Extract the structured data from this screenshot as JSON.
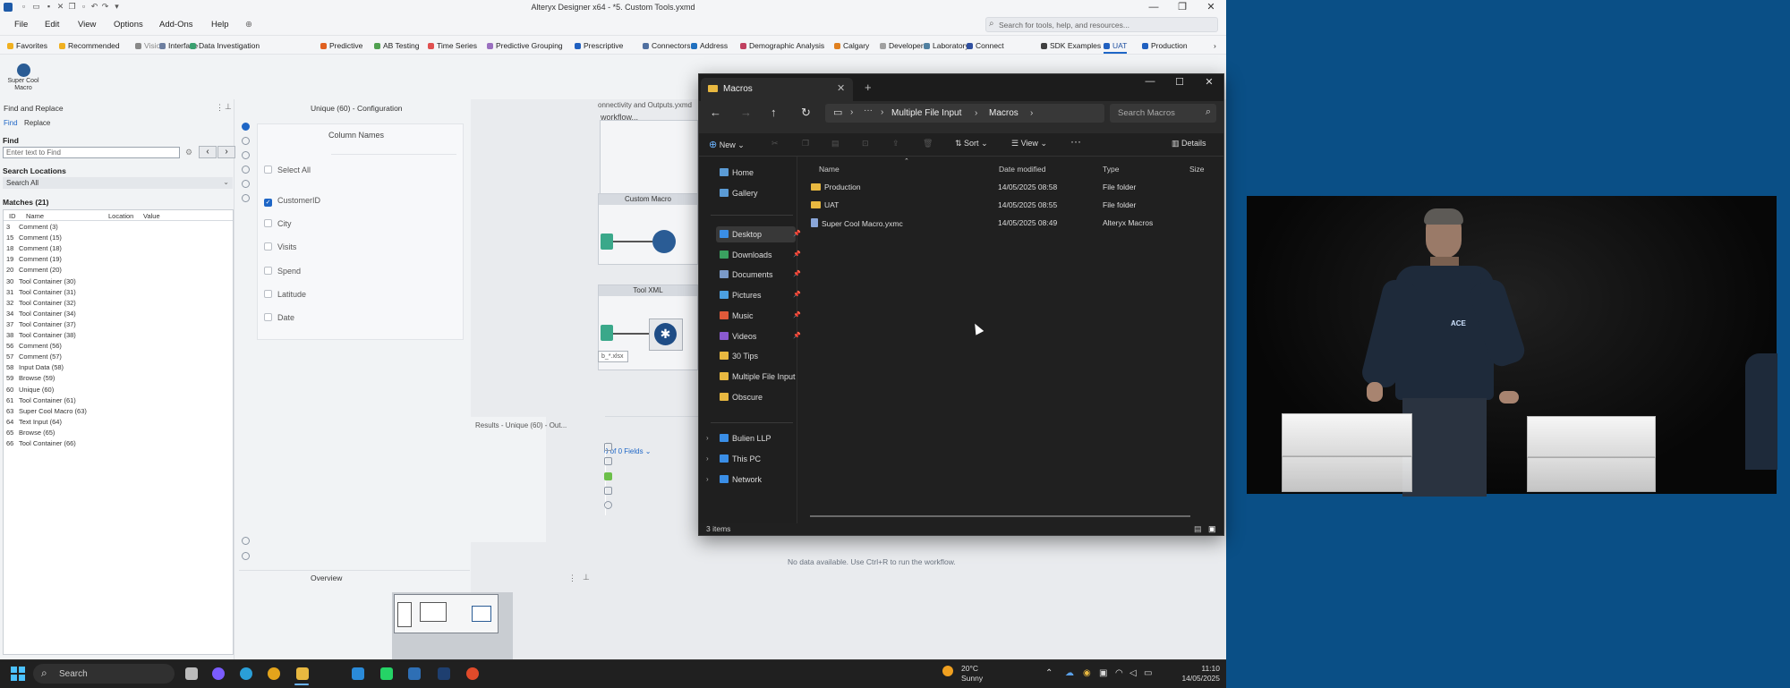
{
  "app": {
    "title": "Alteryx Designer x64 - *5. Custom Tools.yxmd",
    "search_placeholder": "Search for tools, help, and resources...",
    "menu": [
      "File",
      "Edit",
      "View",
      "Options",
      "Add-Ons",
      "Help"
    ]
  },
  "ribbon": {
    "tabs": [
      "Favorites",
      "Recommended",
      "Vision",
      "Interface",
      "Data Investigation",
      "Predictive",
      "AB Testing",
      "Time Series",
      "Predictive Grouping",
      "Prescriptive",
      "Connectors",
      "Address",
      "Demographic Analysis",
      "Calgary",
      "Developer",
      "Laboratory",
      "Connect",
      "SDK Examples",
      "UAT",
      "Production"
    ],
    "active": "UAT",
    "colors": [
      "#f0b020",
      "#f0b020",
      "#888888",
      "#6d7fa0",
      "#3aa070",
      "#e06020",
      "#50a050",
      "#e05050",
      "#9a70c0",
      "#2060c0",
      "#5070a0",
      "#2070c0",
      "#c04060",
      "#e08020",
      "#a0a0a0",
      "#5080a0",
      "#3050a0",
      "#404040",
      "#2060c0",
      "#2060c0"
    ]
  },
  "palette": {
    "tool_label": "Super Cool Macro"
  },
  "find_panel": {
    "title": "Find and Replace",
    "tabs": [
      "Find",
      "Replace"
    ],
    "find_label": "Find",
    "find_placeholder": "Enter text to Find",
    "search_locations_label": "Search Locations",
    "search_locations_value": "Search All",
    "matches_label": "Matches (21)",
    "columns": [
      "ID",
      "Name",
      "Location",
      "Value"
    ],
    "rows": [
      {
        "id": "3",
        "name": "Comment (3)"
      },
      {
        "id": "15",
        "name": "Comment (15)"
      },
      {
        "id": "18",
        "name": "Comment (18)"
      },
      {
        "id": "19",
        "name": "Comment (19)"
      },
      {
        "id": "20",
        "name": "Comment (20)"
      },
      {
        "id": "30",
        "name": "Tool Container (30)"
      },
      {
        "id": "31",
        "name": "Tool Container (31)"
      },
      {
        "id": "32",
        "name": "Tool Container (32)"
      },
      {
        "id": "34",
        "name": "Tool Container (34)"
      },
      {
        "id": "37",
        "name": "Tool Container (37)"
      },
      {
        "id": "38",
        "name": "Tool Container (38)"
      },
      {
        "id": "56",
        "name": "Comment (56)"
      },
      {
        "id": "57",
        "name": "Comment (57)"
      },
      {
        "id": "58",
        "name": "Input Data (58)"
      },
      {
        "id": "59",
        "name": "Browse (59)"
      },
      {
        "id": "60",
        "name": "Unique (60)"
      },
      {
        "id": "61",
        "name": "Tool Container (61)"
      },
      {
        "id": "63",
        "name": "Super Cool Macro (63)"
      },
      {
        "id": "64",
        "name": "Text Input (64)"
      },
      {
        "id": "65",
        "name": "Browse (65)"
      },
      {
        "id": "66",
        "name": "Tool Container (66)"
      }
    ]
  },
  "config": {
    "title": "Unique (60) - Configuration",
    "section": "Column Names",
    "select_all": "Select All",
    "columns": [
      {
        "name": "CustomerID",
        "checked": true
      },
      {
        "name": "City",
        "checked": false
      },
      {
        "name": "Visits",
        "checked": false
      },
      {
        "name": "Spend",
        "checked": false
      },
      {
        "name": "Latitude",
        "checked": false
      },
      {
        "name": "Date",
        "checked": false
      }
    ]
  },
  "canvas": {
    "tab_label": "onnectivity and Outputs.yxmd",
    "workflow_label": "workflow...",
    "container1": "Custom Macro",
    "container2": "Tool XML",
    "node_label": "b_*.xlsx",
    "results_title": "Results - Unique (60) - Out...",
    "fields_text": "0 of 0 Fields",
    "no_data": "No data available. Use Ctrl+R to run the workflow."
  },
  "overview": {
    "title": "Overview"
  },
  "explorer": {
    "tab_title": "Macros",
    "breadcrumb": [
      "Multiple File Input",
      "Macros"
    ],
    "search_placeholder": "Search Macros",
    "commands": {
      "new": "New",
      "sort": "Sort",
      "view": "View",
      "details": "Details"
    },
    "nav_quick": [
      {
        "label": "Home",
        "color": "#5b9bd5"
      },
      {
        "label": "Gallery",
        "color": "#5b9bd5"
      }
    ],
    "nav_pinned": [
      {
        "label": "Desktop",
        "color": "#3a8ee6",
        "pinned": true
      },
      {
        "label": "Downloads",
        "color": "#3aa060",
        "pinned": true
      },
      {
        "label": "Documents",
        "color": "#7a9ac8",
        "pinned": true
      },
      {
        "label": "Pictures",
        "color": "#4ca0e0",
        "pinned": true
      },
      {
        "label": "Music",
        "color": "#e05a3a",
        "pinned": true
      },
      {
        "label": "Videos",
        "color": "#8a5ad0",
        "pinned": true
      },
      {
        "label": "30 Tips",
        "color": "#e8b840",
        "pinned": false
      },
      {
        "label": "Multiple File Input",
        "color": "#e8b840",
        "pinned": false
      },
      {
        "label": "Obscure",
        "color": "#e8b840",
        "pinned": false
      }
    ],
    "nav_roots": [
      {
        "label": "Bulien LLP",
        "color": "#3a8ee6"
      },
      {
        "label": "This PC",
        "color": "#3a8ee6"
      },
      {
        "label": "Network",
        "color": "#3a8ee6"
      }
    ],
    "columns": [
      "Name",
      "Date modified",
      "Type",
      "Size"
    ],
    "files": [
      {
        "name": "Production",
        "date": "14/05/2025 08:58",
        "type": "File folder",
        "kind": "folder"
      },
      {
        "name": "UAT",
        "date": "14/05/2025 08:55",
        "type": "File folder",
        "kind": "folder"
      },
      {
        "name": "Super Cool  Macro.yxmc",
        "date": "14/05/2025 08:49",
        "type": "Alteryx Macros",
        "kind": "file"
      }
    ],
    "status": "3 items"
  },
  "taskbar": {
    "search": "Search",
    "temp": "20°C",
    "weather": "Sunny",
    "time": "11:10",
    "date": "14/05/2025",
    "apps": [
      {
        "name": "task-view",
        "color": "#bbbbbb"
      },
      {
        "name": "copilot",
        "color": "#7b5cff"
      },
      {
        "name": "edge",
        "color": "#2a9fd8"
      },
      {
        "name": "chrome",
        "color": "#e4a41b"
      },
      {
        "name": "file-explorer",
        "color": "#e8b840"
      },
      {
        "name": "notepad",
        "color": "#2a8ad8"
      },
      {
        "name": "whatsapp",
        "color": "#25d366"
      },
      {
        "name": "alteryx-designer",
        "color": "#2e6fb5"
      },
      {
        "name": "alteryx-app",
        "color": "#1e3f70"
      },
      {
        "name": "record",
        "color": "#e04a2a"
      }
    ]
  },
  "video": {
    "shirt_badge": "ACE"
  }
}
